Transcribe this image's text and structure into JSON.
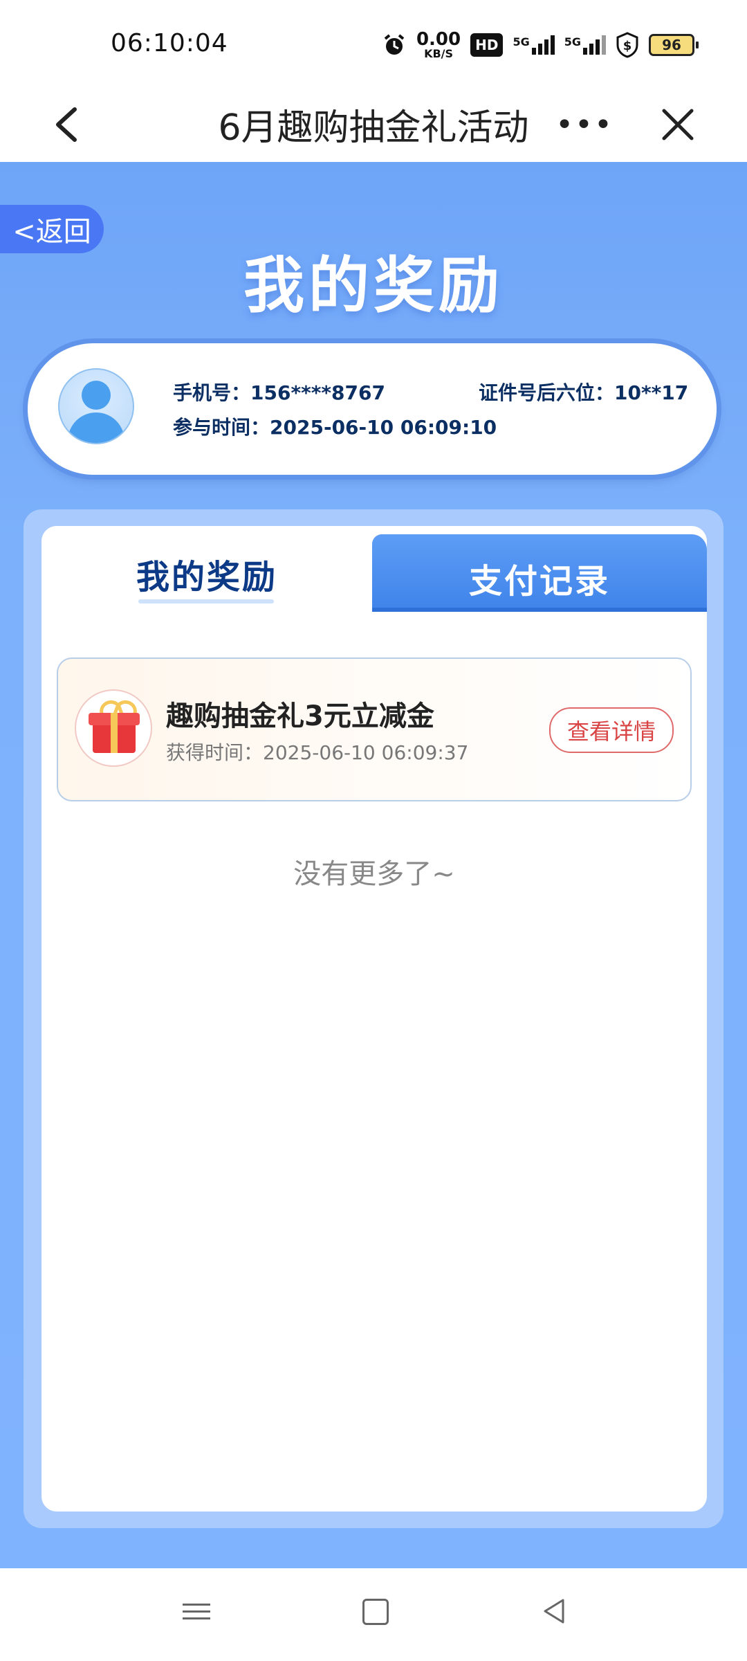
{
  "status_bar": {
    "time": "06:10:04",
    "net_speed_value": "0.00",
    "net_speed_unit": "KB/S",
    "hd_badge": "HD",
    "signal1_label": "5G",
    "signal2_label": "5G",
    "battery": "96",
    "icons": [
      "alarm-icon",
      "hd-icon",
      "signal-5g-icon",
      "signal-5g-icon",
      "shield-dollar-icon",
      "battery-icon"
    ]
  },
  "nav": {
    "title": "6月趣购抽金礼活动",
    "more": "•••"
  },
  "page": {
    "back_label": "<返回",
    "heading": "我的奖励"
  },
  "user": {
    "phone_label": "手机号：",
    "phone": "156****8767",
    "id_label": "证件号后六位：",
    "id_last6": "10**17",
    "join_label": "参与时间：",
    "join_time": "2025-06-10 06:09:10"
  },
  "tabs": [
    {
      "label": "我的奖励",
      "active": true
    },
    {
      "label": "支付记录",
      "active": false
    }
  ],
  "rewards": [
    {
      "title": "趣购抽金礼3元立减金",
      "time_label": "获得时间：",
      "time": "2025-06-10 06:09:37",
      "action": "查看详情"
    }
  ],
  "list_end": "没有更多了~",
  "colors": {
    "primary_blue": "#4a78f5",
    "background_blue": "#7db1fb",
    "tab_active_text": "#0d3a86",
    "detail_red": "#d94545"
  }
}
